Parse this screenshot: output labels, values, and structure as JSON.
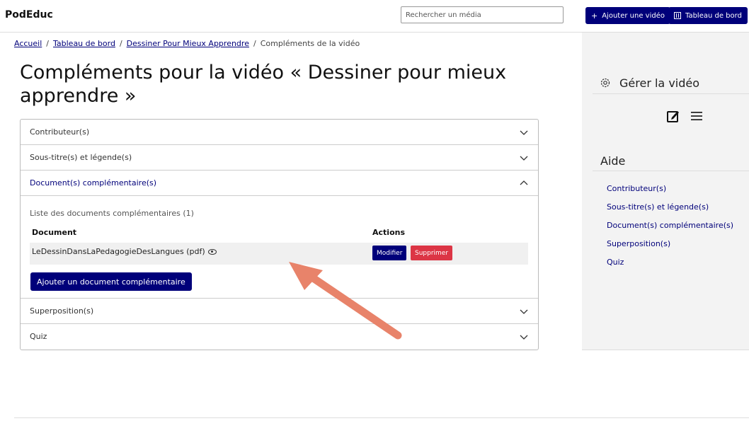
{
  "header": {
    "brand": "PodEduc",
    "search_placeholder": "Rechercher un média",
    "add_video_label": "Ajouter une vidéo",
    "dashboard_label": "Tableau de bord"
  },
  "breadcrumb": {
    "items": [
      "Accueil",
      "Tableau de bord",
      "Dessiner Pour Mieux Apprendre"
    ],
    "current": "Compléments de la vidéo"
  },
  "page_title": "Compléments pour la vidéo « Dessiner pour mieux apprendre »",
  "accordion": {
    "contributors": "Contributeur(s)",
    "subtitles": "Sous-titre(s) et légende(s)",
    "documents": "Document(s) complémentaire(s)",
    "overlays": "Superposition(s)",
    "quiz": "Quiz"
  },
  "documents": {
    "list_title": "Liste des documents complémentaires (1)",
    "col_document": "Document",
    "col_actions": "Actions",
    "rows": [
      {
        "name": "LeDessinDansLaPedagogieDesLangues (pdf)"
      }
    ],
    "modify_label": "Modifier",
    "delete_label": "Supprimer",
    "add_label": "Ajouter un document complémentaire"
  },
  "sidebar": {
    "manage_title": "Gérer la vidéo",
    "help_title": "Aide",
    "links": [
      "Contributeur(s)",
      "Sous-titre(s) et légende(s)",
      "Document(s) complémentaire(s)",
      "Superposition(s)",
      "Quiz"
    ]
  },
  "colors": {
    "primary": "#00007a",
    "danger": "#dc3545",
    "arrow": "#e8836a"
  }
}
